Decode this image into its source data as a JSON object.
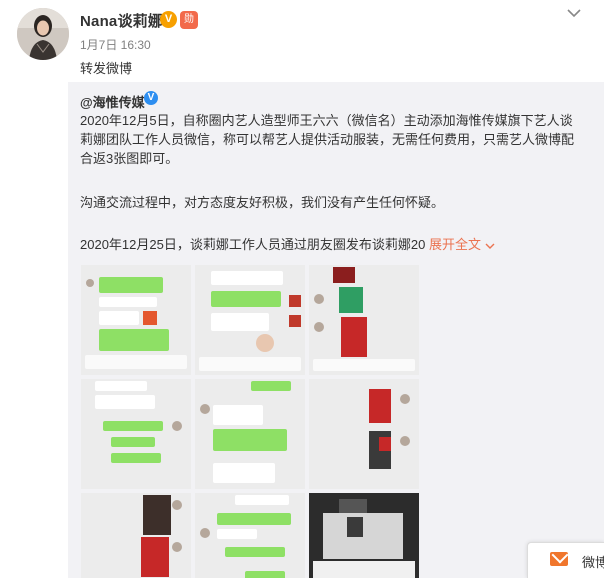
{
  "post": {
    "username": "Nana谈莉娜",
    "verified_badge": "V",
    "medal_badge": "勋",
    "timestamp": "1月7日 16:30",
    "repost_text": "转发微博",
    "more_icon": "chevron-down-icon"
  },
  "original": {
    "author": "@海惟传媒",
    "verified": "V",
    "paragraphs": [
      "2020年12月5日，自称圈内艺人造型师王六六（微信名）主动添加海惟传媒旗下艺人谈莉娜团队工作人员微信，称可以帮艺人提供活动服装，无需任何费用，只需艺人微博配合返3张图即可。",
      "沟通交流过程中，对方态度友好积极，我们没有产生任何怀疑。",
      "2020年12月25日，谈莉娜工作人员通过朋友圈发布谈莉娜20"
    ],
    "expand_label": "展开全文",
    "expand_icon": "chevron-down-icon",
    "images": [
      "chat-screenshot-1",
      "chat-screenshot-2",
      "photo-screenshot-3",
      "chat-screenshot-4",
      "chat-screenshot-5",
      "photo-screenshot-6",
      "chat-screenshot-7",
      "chat-screenshot-8",
      "photo-screenshot-9"
    ]
  },
  "messages": {
    "label": "微博",
    "icon": "mail-icon"
  },
  "colors": {
    "accent_orange": "#eb7350",
    "verified_blue": "#2d8ef0",
    "chat_green": "#8ee065",
    "quote_bg": "#f2f2f5"
  }
}
